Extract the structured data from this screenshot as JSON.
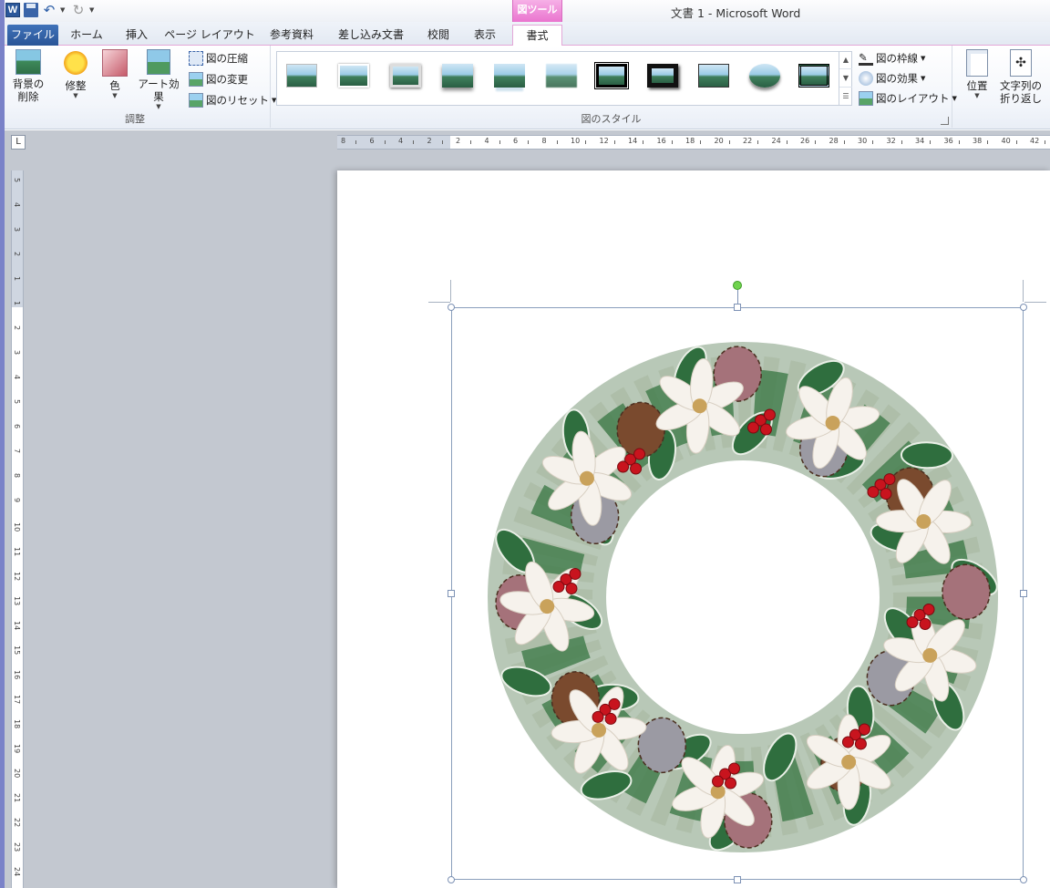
{
  "app": {
    "window_title": "文書 1 - Microsoft Word",
    "contextual_tab_label": "図ツール"
  },
  "tabs": [
    {
      "label": "ファイル",
      "selected": false
    },
    {
      "label": "ホーム",
      "selected": false
    },
    {
      "label": "挿入",
      "selected": false
    },
    {
      "label": "ページ レイアウト",
      "selected": false
    },
    {
      "label": "参考資料",
      "selected": false
    },
    {
      "label": "差し込み文書",
      "selected": false
    },
    {
      "label": "校閲",
      "selected": false
    },
    {
      "label": "表示",
      "selected": false
    },
    {
      "label": "書式",
      "selected": true
    }
  ],
  "ribbon": {
    "adjust": {
      "group_label": "調整",
      "remove_background_line1": "背景の",
      "remove_background_line2": "削除",
      "corrections": "修整",
      "color": "色",
      "artistic_effects": "アート効果",
      "compress": "図の圧縮",
      "change_picture": "図の変更",
      "reset_picture": "図のリセット"
    },
    "styles": {
      "group_label": "図のスタイル",
      "thumbnail_count": 11,
      "border": "図の枠線",
      "effects": "図の効果",
      "layout": "図のレイアウト"
    },
    "arrange": {
      "position": "位置",
      "wrap_line1": "文字列の",
      "wrap_line2": "折り返し"
    }
  },
  "rulers": {
    "horizontal_numbers": [
      "8",
      "6",
      "4",
      "2",
      "2",
      "4",
      "6",
      "8",
      "10",
      "12",
      "14",
      "16",
      "18",
      "20",
      "22",
      "24",
      "26",
      "28",
      "30",
      "32",
      "34",
      "36",
      "38",
      "40",
      "42"
    ],
    "vertical_numbers": [
      "5",
      "4",
      "3",
      "2",
      "1",
      "1",
      "2",
      "3",
      "4",
      "5",
      "6",
      "7",
      "8",
      "9",
      "10",
      "11",
      "12",
      "13",
      "14",
      "15",
      "16",
      "17",
      "18",
      "19",
      "20",
      "21",
      "22",
      "23",
      "24"
    ],
    "tab_selector": "L"
  },
  "document": {
    "picture_subject": "christmas-wreath",
    "picture_selected": true
  },
  "colors": {
    "accent_blue": "#2b579a",
    "contextual_pink": "#ea74cf",
    "workspace_gray": "#c3c8d0"
  }
}
